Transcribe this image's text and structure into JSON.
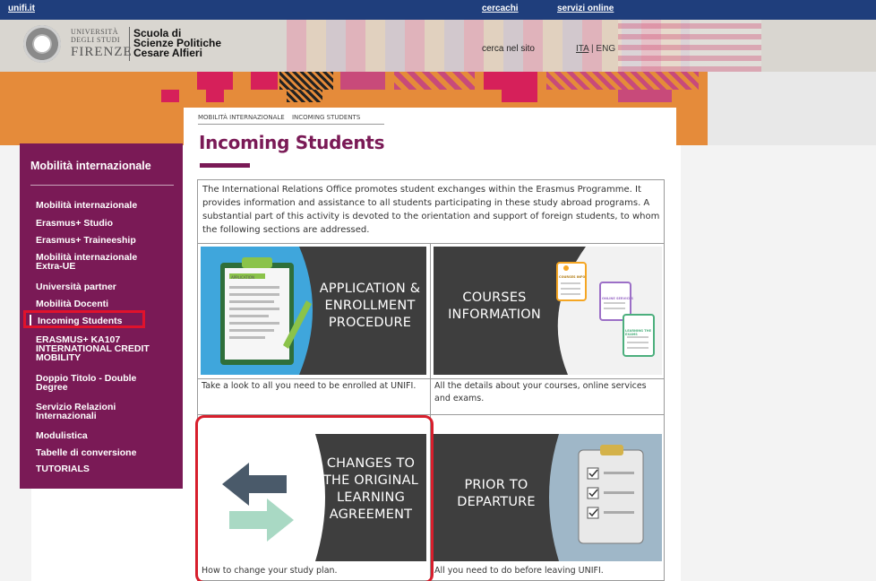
{
  "topbar": {
    "home_link": "unifi.it",
    "search_link": "cercachi",
    "services_link": "servizi online"
  },
  "header": {
    "uni_line1": "UNIVERSITÀ",
    "uni_line2": "DEGLI STUDI",
    "uni_line3": "FIRENZE",
    "school_line1": "Scuola di",
    "school_line2": "Scienze Politiche",
    "school_line3": "Cesare Alfieri",
    "site_search_label": "cerca nel sito",
    "lang_ita": "ITA",
    "lang_sep": " | ",
    "lang_eng": "ENG"
  },
  "sidebar": {
    "title": "Mobilità internazionale",
    "items": [
      {
        "label": "Mobilità internazionale"
      },
      {
        "label": "Erasmus+ Studio"
      },
      {
        "label": "Erasmus+ Traineeship"
      },
      {
        "label": "Mobilità internazionale Extra-UE"
      },
      {
        "label": "Università partner"
      },
      {
        "label": "Mobilità Docenti"
      },
      {
        "label": "Incoming Students"
      },
      {
        "label": "ERASMUS+ KA107 INTERNATIONAL CREDIT MOBILITY"
      },
      {
        "label": "Doppio Titolo - Double Degree"
      },
      {
        "label": "Servizio Relazioni Internazionali"
      },
      {
        "label": "Modulistica"
      },
      {
        "label": "Tabelle di conversione"
      },
      {
        "label": "TUTORIALS"
      }
    ]
  },
  "breadcrumb": [
    "MOBILITÀ INTERNAZIONALE",
    "INCOMING STUDENTS"
  ],
  "page": {
    "title": "Incoming Students",
    "intro": "The International Relations Office promotes student exchanges within the Erasmus Programme. It provides information and assistance to all students participating in these study abroad programs. A substantial part of this activity is devoted to the orientation and support of foreign students, to whom the following sections are addressed."
  },
  "tiles": [
    {
      "line1": "APPLICATION &",
      "line2": "ENROLLMENT",
      "line3": "PROCEDURE",
      "caption": "Take a look to all you need to be enrolled at UNIFI.",
      "image_label": "APPLICATION"
    },
    {
      "line1": "COURSES",
      "line2": "INFORMATION",
      "caption": "All the details about your courses, online services and exams.",
      "img_labels": [
        "COURSES INFO",
        "ONLINE SERVICES",
        "LEARNING THE EXAMS"
      ]
    },
    {
      "line1": "CHANGES TO",
      "line2": "THE ORIGINAL",
      "line3": "LEARNING",
      "line4": "AGREEMENT",
      "caption": "How to change your study plan."
    },
    {
      "line1": "PRIOR TO",
      "line2": "DEPARTURE",
      "caption": "All you need to do before leaving UNIFI."
    }
  ],
  "colors": {
    "brand_purple": "#7a1a56",
    "topbar_blue": "#1f3e7c",
    "highlight_red": "#d71e2c",
    "tile_dark": "#3e3e3e",
    "banner_orange": "#e58b3a"
  }
}
